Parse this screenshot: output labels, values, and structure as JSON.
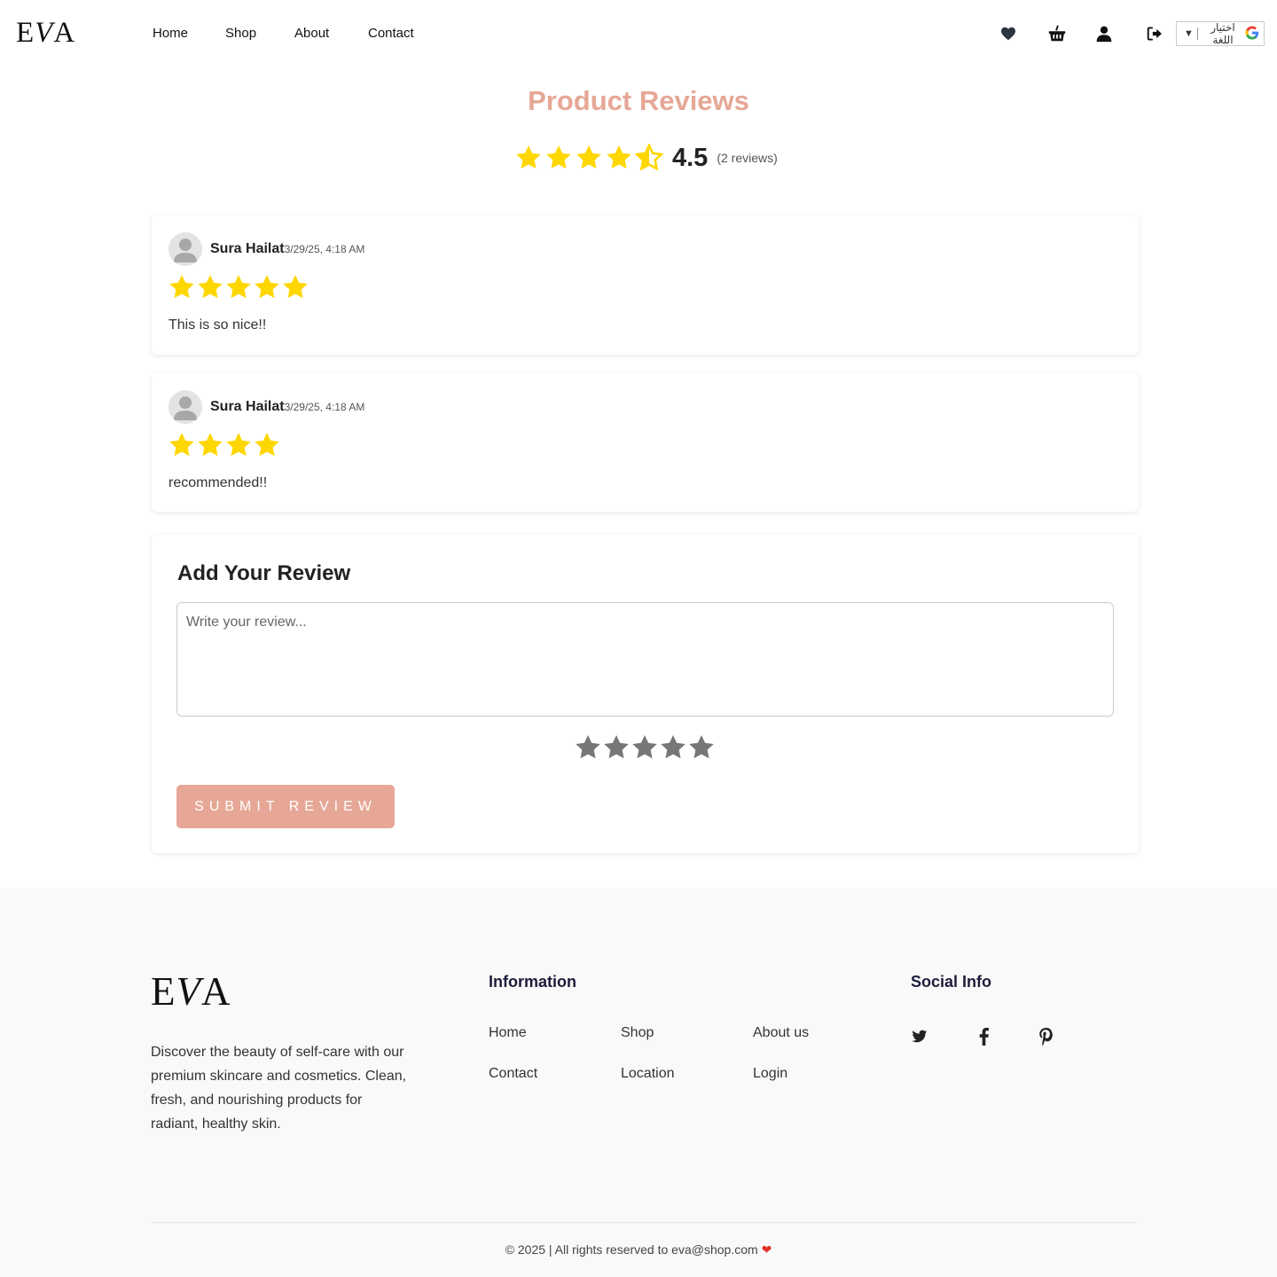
{
  "header": {
    "logo": "EVA",
    "nav": [
      "Home",
      "Shop",
      "About",
      "Contact"
    ],
    "language_selector": "اختيار اللغة",
    "icons": [
      "heart-icon",
      "basket-icon",
      "user-icon",
      "logout-icon"
    ]
  },
  "reviews_section": {
    "title": "Product Reviews",
    "average_rating": "4.5",
    "average_value": 4.5,
    "review_count_text": "(2 reviews)",
    "star_color": "#FFD700"
  },
  "reviews": [
    {
      "author": "Sura Hailat",
      "date": "3/29/25, 4:18 AM",
      "rating": 5,
      "text": "This is so nice!!"
    },
    {
      "author": "Sura Hailat",
      "date": "3/29/25, 4:18 AM",
      "rating": 4,
      "text": "recommended!!"
    }
  ],
  "add_review": {
    "title": "Add Your Review",
    "placeholder": "Write your review...",
    "rating_selected": 0,
    "submit_label": "SUBMIT REVIEW",
    "accent_color": "#e6a796"
  },
  "footer": {
    "logo": "EVA",
    "description": "Discover the beauty of self-care with our premium skincare and cosmetics. Clean, fresh, and nourishing products for radiant, healthy skin.",
    "information_heading": "Information",
    "links": [
      "Home",
      "Shop",
      "About us",
      "Contact",
      "Location",
      "Login"
    ],
    "social_heading": "Social Info",
    "social_icons": [
      "twitter-icon",
      "facebook-icon",
      "pinterest-icon"
    ],
    "copyright": "© 2025 | All rights reserved to eva@shop.com"
  }
}
